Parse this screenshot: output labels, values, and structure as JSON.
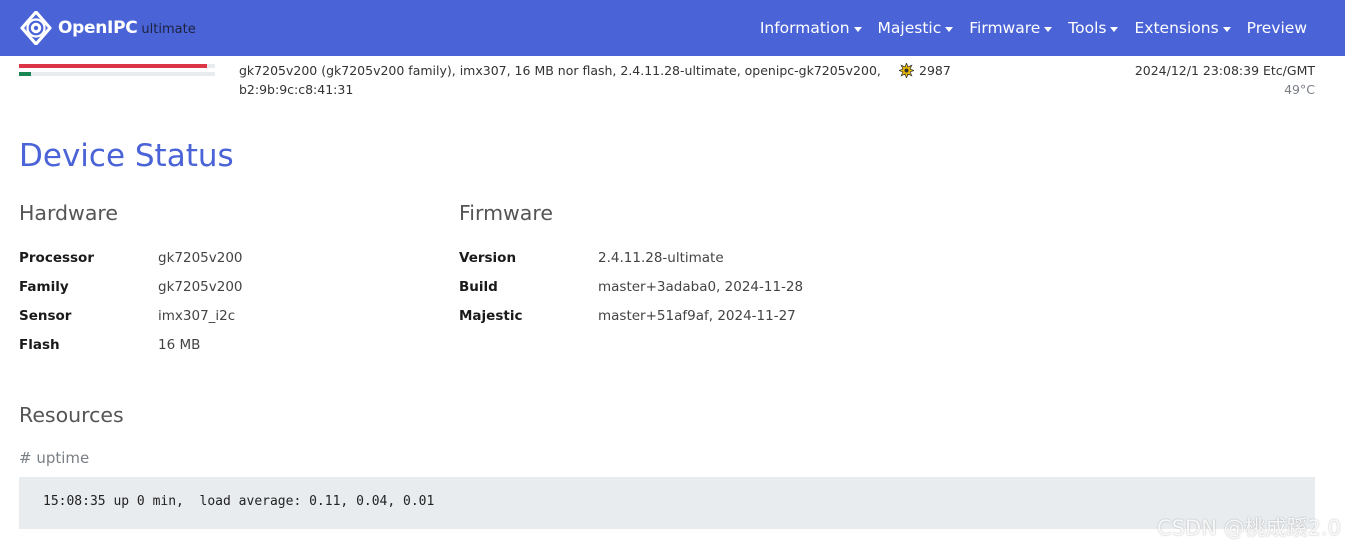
{
  "navbar": {
    "brand_name": "OpenIPC",
    "brand_sub": "ultimate",
    "items": [
      {
        "label": "Information"
      },
      {
        "label": "Majestic"
      },
      {
        "label": "Firmware"
      },
      {
        "label": "Tools"
      },
      {
        "label": "Extensions"
      },
      {
        "label": "Preview"
      }
    ],
    "bg_color": "#4a63d6"
  },
  "status_bar": {
    "memory_usage_fraction": 0.96,
    "memory_color": "#dc3545",
    "cpu_usage_fraction": 0.06,
    "cpu_color": "#198754",
    "device_info": "gk7205v200 (gk7205v200 family), imx307, 16 MB nor flash, 2.4.11.28-ultimate, openipc-gk7205v200, b2:9b:9c:c8:41:31",
    "uptime_seconds": "2987",
    "uptime_icon": "sun-burst-icon",
    "datetime": "2024/12/1 23:08:39 Etc/GMT",
    "temperature": "49°C"
  },
  "page": {
    "title": "Device Status",
    "title_color": "#4a63d6"
  },
  "hardware": {
    "title": "Hardware",
    "rows": [
      {
        "key": "Processor",
        "value": "gk7205v200"
      },
      {
        "key": "Family",
        "value": "gk7205v200"
      },
      {
        "key": "Sensor",
        "value": "imx307_i2c"
      },
      {
        "key": "Flash",
        "value": "16 MB"
      }
    ]
  },
  "firmware": {
    "title": "Firmware",
    "rows": [
      {
        "key": "Version",
        "value": "2.4.11.28-ultimate"
      },
      {
        "key": "Build",
        "value": "master+3adaba0, 2024-11-28"
      },
      {
        "key": "Majestic",
        "value": "master+51af9af, 2024-11-27"
      }
    ]
  },
  "resources": {
    "title": "Resources",
    "command_label": "# uptime",
    "command_output": "15:08:35 up 0 min,  load average: 0.11, 0.04, 0.01"
  },
  "watermark": "CSDN @桃成蹊2.0"
}
